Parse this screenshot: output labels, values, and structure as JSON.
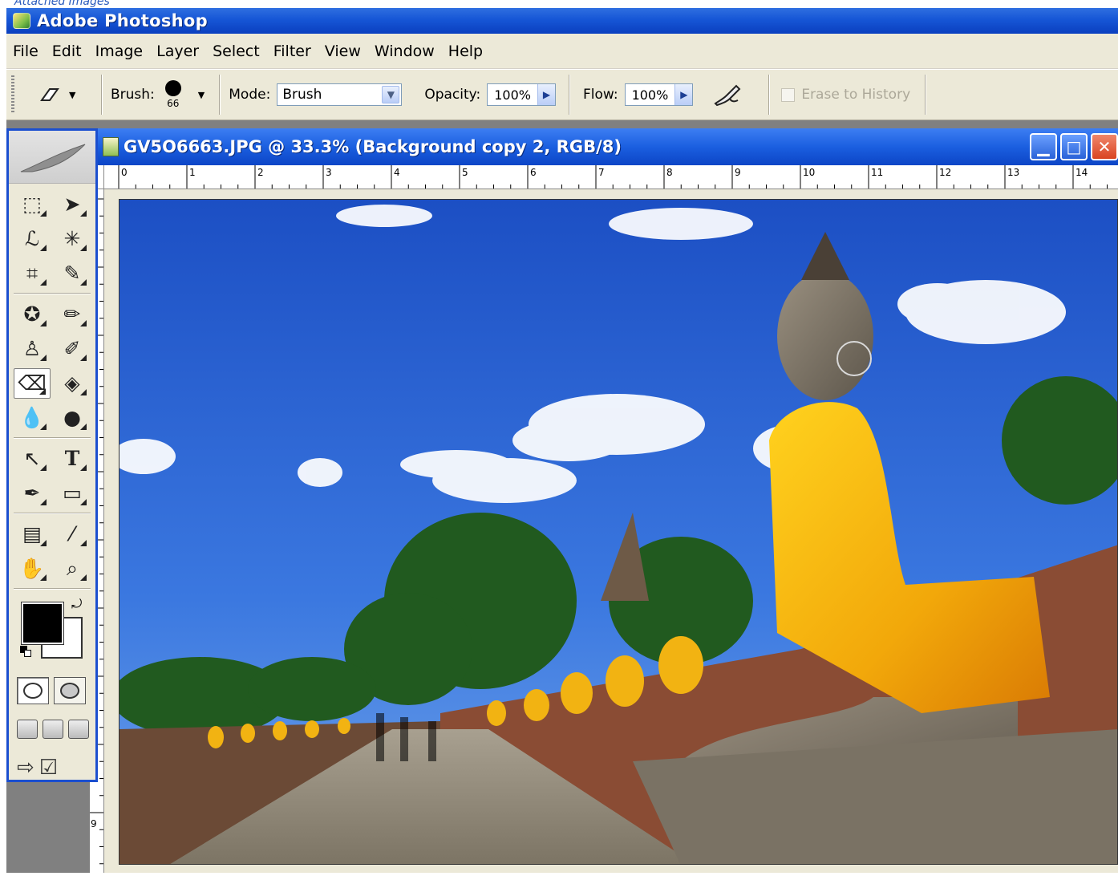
{
  "caption": "Attached Images",
  "app": {
    "title": "Adobe Photoshop"
  },
  "menu": [
    "File",
    "Edit",
    "Image",
    "Layer",
    "Select",
    "Filter",
    "View",
    "Window",
    "Help"
  ],
  "options": {
    "brush_label": "Brush:",
    "brush_size": "66",
    "mode_label": "Mode:",
    "mode_value": "Brush",
    "opacity_label": "Opacity:",
    "opacity_value": "100%",
    "flow_label": "Flow:",
    "flow_value": "100%",
    "erase_to_history": "Erase to History",
    "erase_to_history_checked": false
  },
  "document": {
    "title": "GV5O6663.JPG @ 33.3% (Background copy 2, RGB/8)",
    "zoom": "33.3%"
  },
  "ruler": {
    "horizontal": [
      "0",
      "1",
      "2",
      "3",
      "4",
      "5",
      "6",
      "7",
      "8",
      "9",
      "10",
      "11",
      "12",
      "13",
      "14"
    ],
    "vertical": [
      "9"
    ]
  },
  "toolbox": {
    "active_tool": "eraser",
    "foreground_color": "#000000",
    "background_color": "#ffffff"
  },
  "colors": {
    "titlebar": "#0a3fbf",
    "toolbox_border": "#1b4fcf",
    "chrome": "#ece9d8"
  }
}
